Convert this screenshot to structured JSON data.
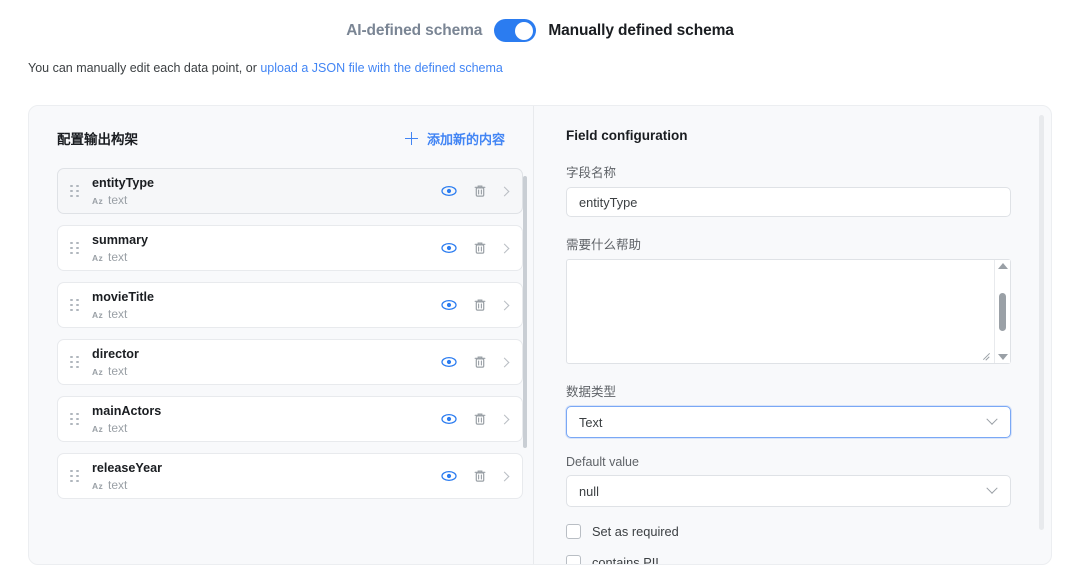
{
  "header": {
    "left_label": "AI-defined schema",
    "right_label": "Manually defined schema",
    "toggle_state": "right",
    "toggle_color": "#2b7cf0"
  },
  "subtitle": {
    "text": "You can manually edit each data point, or ",
    "link_text": "upload a JSON file with the defined schema",
    "link_color": "#4285f4"
  },
  "left_panel": {
    "title": "配置输出构架",
    "add_label": "添加新的内容",
    "fields": [
      {
        "name": "entityType",
        "type": "text",
        "type_icon": "Az",
        "selected": true
      },
      {
        "name": "summary",
        "type": "text",
        "type_icon": "Az",
        "selected": false
      },
      {
        "name": "movieTitle",
        "type": "text",
        "type_icon": "Az",
        "selected": false
      },
      {
        "name": "director",
        "type": "text",
        "type_icon": "Az",
        "selected": false
      },
      {
        "name": "mainActors",
        "type": "text",
        "type_icon": "Az",
        "selected": false
      },
      {
        "name": "releaseYear",
        "type": "text",
        "type_icon": "Az",
        "selected": false
      }
    ],
    "row_icons": [
      "eye-icon",
      "trash-icon",
      "chevron-right-icon"
    ],
    "eye_icon_color": "#2b7cf0",
    "trash_icon_color": "#9aa0a6"
  },
  "right_panel": {
    "title": "Field configuration",
    "field_name_label": "字段名称",
    "field_name_value": "entityType",
    "field_name_placeholder": "",
    "description_label": "需要什么帮助",
    "description_value": "",
    "description_placeholder": "",
    "data_type_label": "数据类型",
    "data_type_value": "Text",
    "default_value_label": "Default value",
    "default_value_value": "null",
    "checkboxes": [
      {
        "label": "Set as required",
        "checked": false
      },
      {
        "label": "contains PII",
        "checked": false
      }
    ]
  }
}
